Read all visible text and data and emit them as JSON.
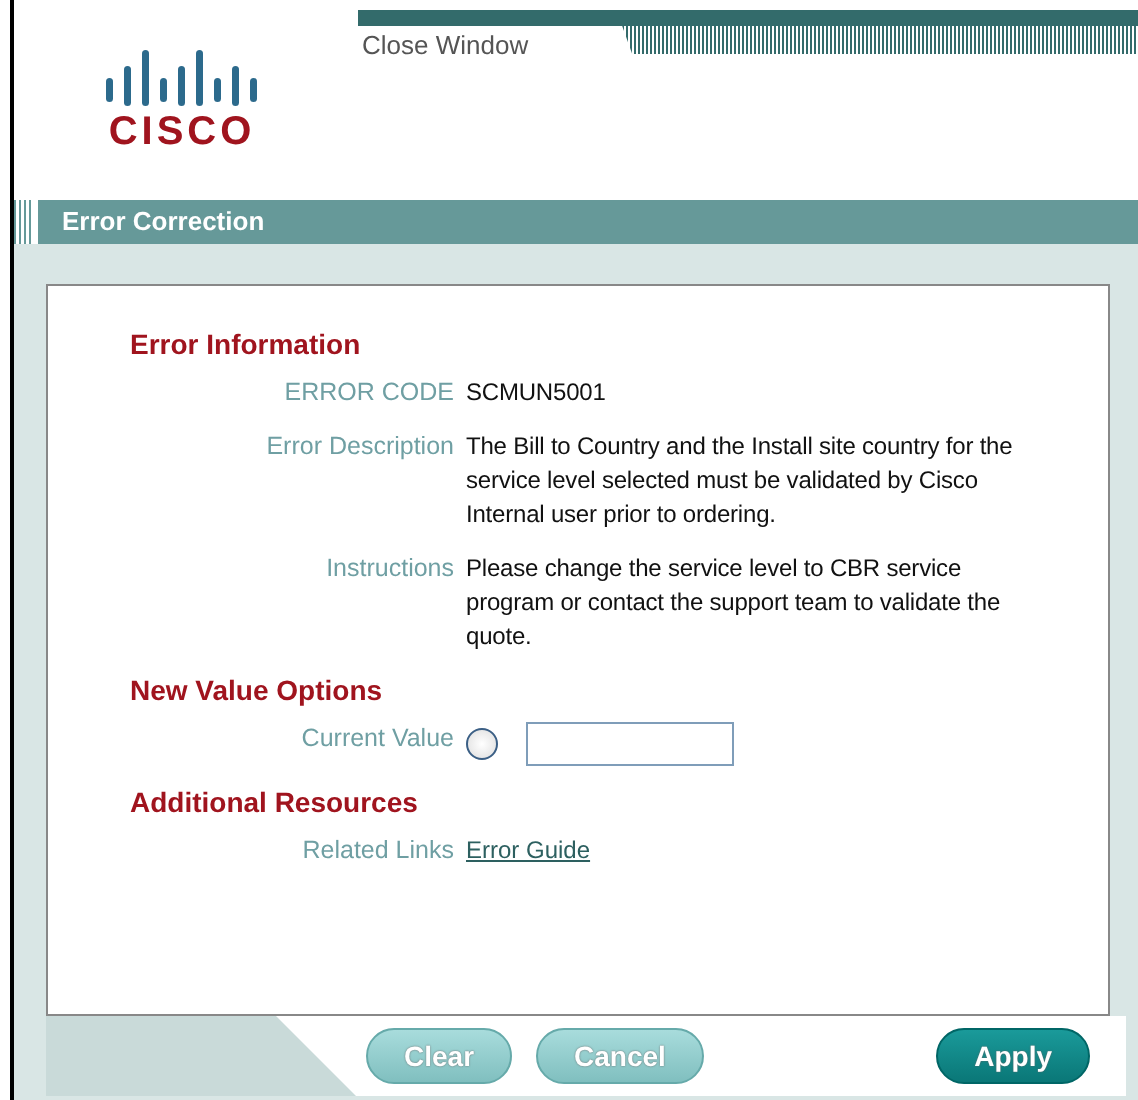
{
  "logo": {
    "text": "CISCO"
  },
  "close_link": "Close Window",
  "header": {
    "title": "Error Correction"
  },
  "sections": [
    {
      "title": "Error Information",
      "rows": [
        {
          "kind": "text",
          "label": "ERROR CODE",
          "value": "SCMUN5001"
        },
        {
          "kind": "text",
          "label": "Error Description",
          "value": "The Bill to Country and the Install site country for the service level selected must be validated by Cisco Internal user prior to ordering."
        },
        {
          "kind": "text",
          "label": "Instructions",
          "value": "Please change the service level to CBR service program or contact the support team to validate the quote."
        }
      ]
    },
    {
      "title": "New Value Options",
      "rows": [
        {
          "kind": "option",
          "label": "Current Value",
          "selected": false
        }
      ]
    },
    {
      "title": "Additional Resources",
      "rows": [
        {
          "kind": "link",
          "label": "Related Links",
          "value": "Error Guide"
        }
      ]
    }
  ],
  "buttons": [
    {
      "label": "Clear",
      "kind": "secondary"
    },
    {
      "label": "Cancel",
      "kind": "secondary"
    },
    {
      "label": "Apply",
      "kind": "primary"
    }
  ]
}
